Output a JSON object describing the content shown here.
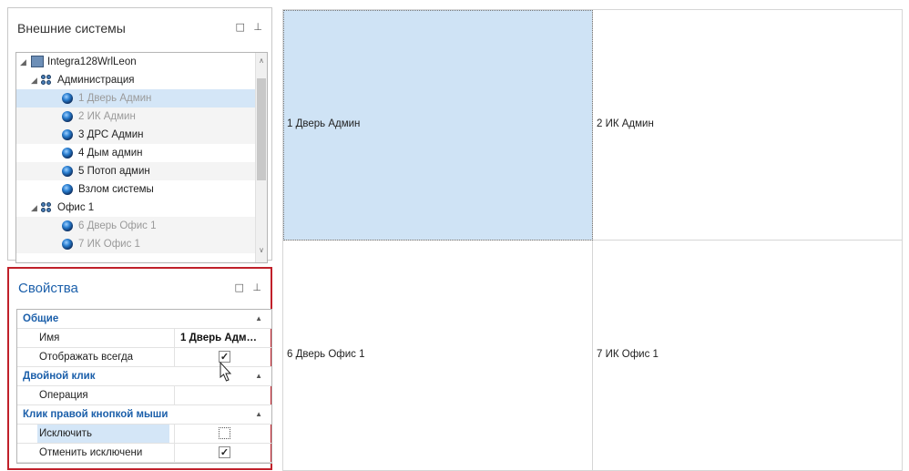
{
  "left": {
    "systems_panel": {
      "title": "Внешние системы",
      "tree": {
        "root": "Integra128WrlLeon",
        "groups": [
          {
            "label": "Администрация",
            "items": [
              "1 Дверь Админ",
              "2 ИК Админ",
              "3 ДРС Админ",
              "4 Дым админ",
              "5 Потоп админ",
              "Взлом системы"
            ]
          },
          {
            "label": "Офис 1",
            "items": [
              "6 Дверь Офис 1",
              "7 ИК Офис 1"
            ]
          }
        ]
      }
    },
    "props_panel": {
      "title": "Свойства",
      "categories": [
        {
          "name": "Общие",
          "rows": [
            {
              "name": "Имя",
              "value": "1 Дверь Адм…"
            },
            {
              "name": "Отображать всегда",
              "checked": true
            }
          ]
        },
        {
          "name": "Двойной клик",
          "rows": [
            {
              "name": "Операция",
              "value": ""
            }
          ]
        },
        {
          "name": "Клик правой кнопкой мыши",
          "rows": [
            {
              "name": "Исключить",
              "checked": false
            },
            {
              "name": "Отменить исключени",
              "checked": true
            }
          ]
        }
      ]
    }
  },
  "main": {
    "cells": [
      "1 Дверь Админ",
      "2 ИК Админ",
      "6 Дверь Офис 1",
      "7 ИК Офис 1"
    ]
  },
  "icons": {
    "minimize": "□",
    "pin": "⊥",
    "collapse": "◢",
    "scroll_up": "∧",
    "scroll_down": "∨",
    "check": "✓",
    "cat_up": "▲"
  },
  "colors": {
    "selection": "#cfe3f5",
    "category_text": "#1b5faa",
    "highlight_border": "#c0202a"
  }
}
